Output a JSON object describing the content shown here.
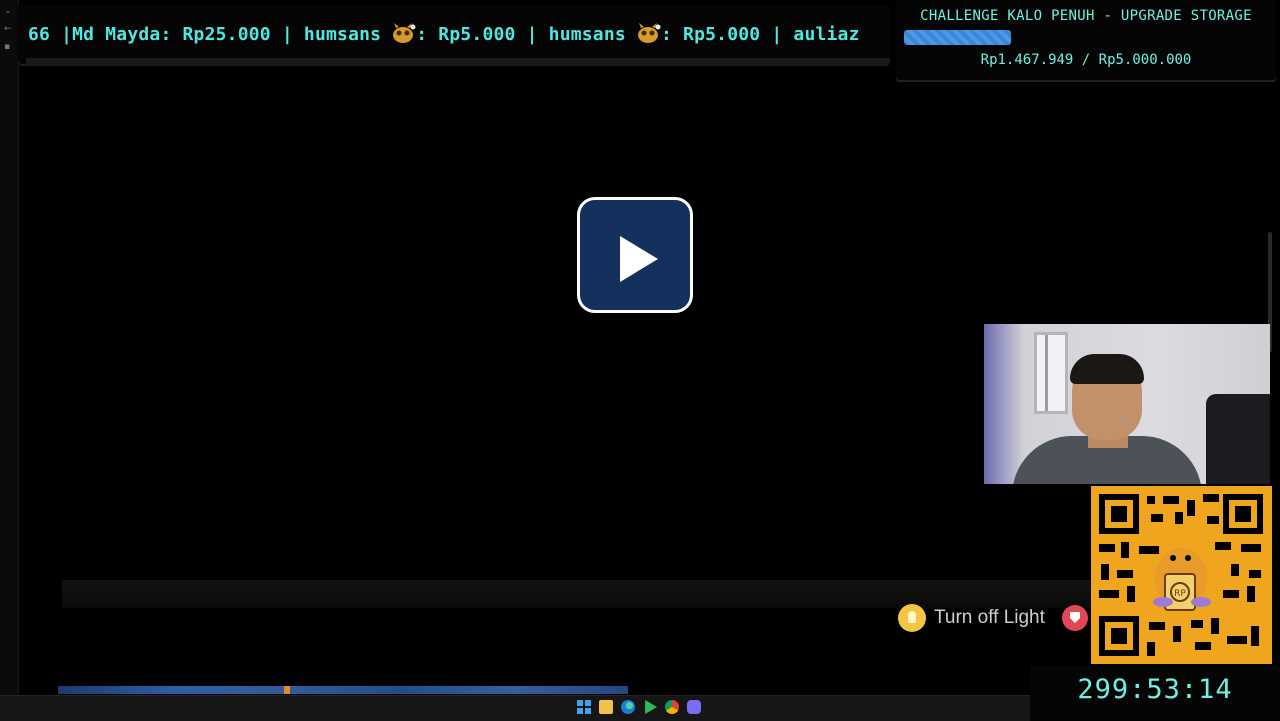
{
  "ticker": {
    "segments": [
      {
        "text": "66 |Md Mayda: Rp25.000 | humsans "
      },
      {
        "text": ": Rp5.000 | humsans "
      },
      {
        "text": ": Rp5.000 | auliaz"
      }
    ],
    "emoji_icon": "monster-emoji-icon"
  },
  "challenge": {
    "title": "CHALLENGE KALO PENUH - UPGRADE STORAGE",
    "amount_text": "Rp1.467.949 / Rp5.000.000",
    "raised": 1467949,
    "goal": 5000000,
    "progress_fraction": 0.2936
  },
  "player": {
    "play_icon": "play-icon",
    "light_toggle_label": "Turn off Light"
  },
  "timer": {
    "value": "299:53:14"
  },
  "taskbar": {
    "icons": [
      "windows-start-icon",
      "file-explorer-icon",
      "edge-icon",
      "play-store-icon",
      "chrome-icon",
      "discord-icon"
    ]
  },
  "colors": {
    "overlay_text": "#4fe7e0",
    "progress_fill": "#3b86d6",
    "play_button": "#13315c",
    "bulb": "#f4c542",
    "badge": "#e04757"
  }
}
